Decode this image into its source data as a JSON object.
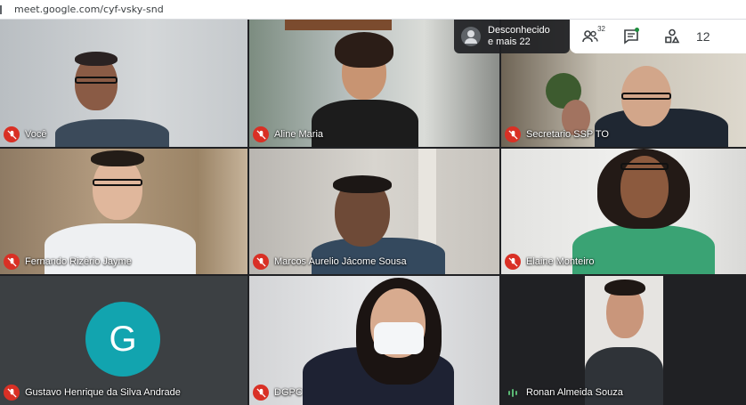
{
  "browser": {
    "url": "meet.google.com/cyf-vsky-snd"
  },
  "overflow": {
    "line1": "Desconhecido",
    "line2": "e mais 22",
    "icon": "person-avatar-icon"
  },
  "toolbar": {
    "people_count": "32",
    "people_icon": "people-icon",
    "chat_icon": "chat-icon",
    "activities_icon": "activities-icon",
    "clock": "12"
  },
  "participants": [
    {
      "name": "Você",
      "mic": "muted"
    },
    {
      "name": "Aline Maria",
      "mic": "muted"
    },
    {
      "name": "Secretario SSP TO",
      "mic": "muted"
    },
    {
      "name": "Fernando Rizério Jayme",
      "mic": "muted"
    },
    {
      "name": "Marcos Aurelio Jácome Sousa",
      "mic": "muted"
    },
    {
      "name": "Elaine Monteiro",
      "mic": "muted"
    },
    {
      "name": "Gustavo Henrique da Silva Andrade",
      "mic": "muted",
      "avatar_letter": "G"
    },
    {
      "name": "DGPC",
      "mic": "muted"
    },
    {
      "name": "Ronan Almeida Souza",
      "mic": "speaking"
    }
  ],
  "colors": {
    "muted": "#d93025",
    "avatar": "#12a4af",
    "speaking": "#5bb974"
  }
}
